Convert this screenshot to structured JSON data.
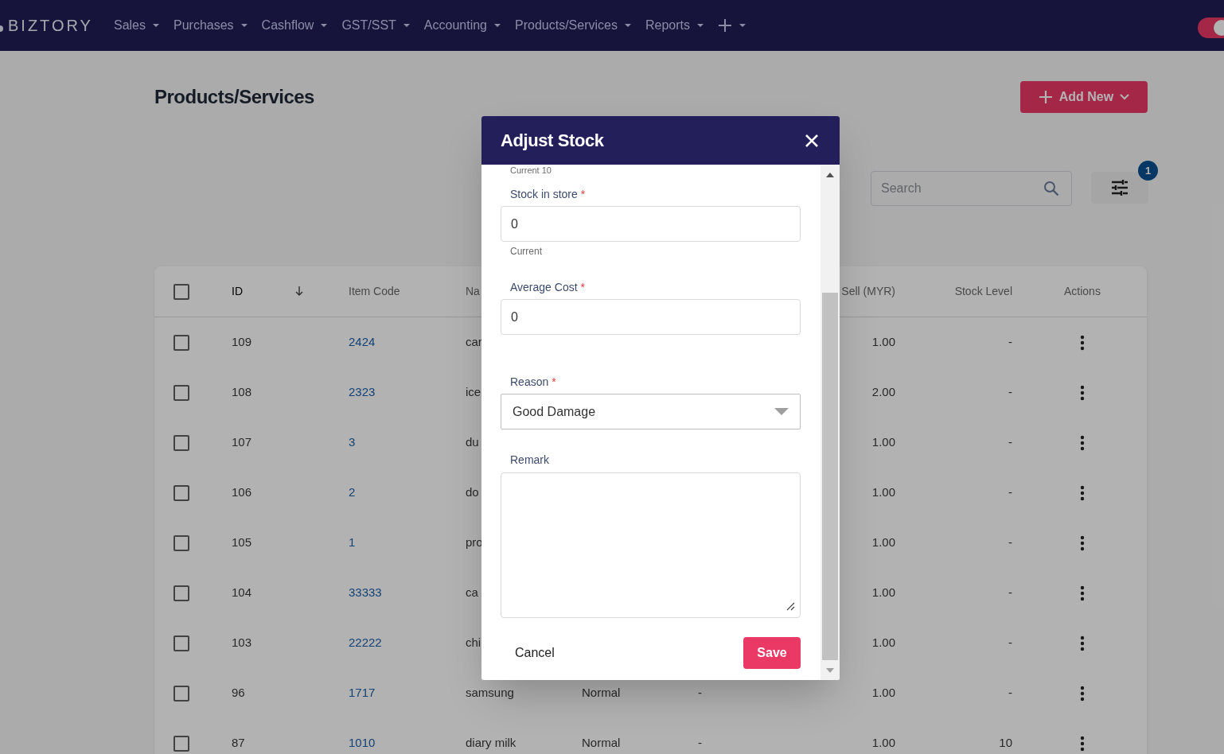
{
  "nav": {
    "logo": "BIZTORY",
    "items": [
      {
        "kind": "menu",
        "label": "Sales"
      },
      {
        "kind": "menu",
        "label": "Purchases"
      },
      {
        "kind": "menu",
        "label": "Cashflow"
      },
      {
        "kind": "menu",
        "label": "GST/SST"
      },
      {
        "kind": "menu",
        "label": "Accounting"
      },
      {
        "kind": "menu",
        "label": "Products/Services"
      },
      {
        "kind": "menu",
        "label": "Reports"
      },
      {
        "kind": "add"
      }
    ],
    "toggle": {
      "on": true
    }
  },
  "page": {
    "title": "Products/Services",
    "add_button": "Add New",
    "search": {
      "placeholder": "Search"
    },
    "filter_badge": "1"
  },
  "table": {
    "select_all": {
      "checked": false
    },
    "columns": [
      {
        "kind": "text",
        "label": "ID",
        "sorted": true
      },
      {
        "kind": "text",
        "label": "Item Code"
      },
      {
        "kind": "text",
        "label": "Na"
      },
      {
        "kind": "covered"
      },
      {
        "kind": "covered"
      },
      {
        "kind": "text",
        "label": "Sell (MYR)"
      },
      {
        "kind": "text",
        "label": "Stock Level"
      },
      {
        "kind": "text",
        "label": "Actions"
      }
    ],
    "rows": [
      {
        "checked": false,
        "id": "109",
        "item_code": "2424",
        "name": "car",
        "sell": "1.00",
        "stock_level": "-"
      },
      {
        "checked": false,
        "id": "108",
        "item_code": "2323",
        "name": "ice",
        "sell": "2.00",
        "stock_level": "-"
      },
      {
        "checked": false,
        "id": "107",
        "item_code": "3",
        "name": "du",
        "sell": "1.00",
        "stock_level": "-"
      },
      {
        "checked": false,
        "id": "106",
        "item_code": "2",
        "name": "do",
        "sell": "1.00",
        "stock_level": "-"
      },
      {
        "checked": false,
        "id": "105",
        "item_code": "1",
        "name": "pro",
        "sell": "1.00",
        "stock_level": "-"
      },
      {
        "checked": false,
        "id": "104",
        "item_code": "33333",
        "name": "ca",
        "sell": "1.00",
        "stock_level": "-"
      },
      {
        "checked": false,
        "id": "103",
        "item_code": "22222",
        "name": "chi",
        "sell": "1.00",
        "stock_level": "-"
      },
      {
        "checked": false,
        "id": "96",
        "item_code": "1717",
        "name": "samsung",
        "column_5": "Normal",
        "column_6": "-",
        "sell": "1.00",
        "stock_level": "-"
      },
      {
        "checked": false,
        "id": "87",
        "item_code": "1010",
        "name": "diary milk",
        "column_5": "Normal",
        "column_6": "-",
        "sell": "1.00",
        "stock_level": "10"
      }
    ]
  },
  "modal": {
    "title": "Adjust Stock",
    "scrolled_helper": "Current 10",
    "fields": [
      {
        "kind": "number",
        "label": "Stock in store",
        "required_mark": "*",
        "value": "0",
        "helper": "Current"
      },
      {
        "kind": "number",
        "label": "Average Cost",
        "required_mark": "*",
        "value": "0"
      },
      {
        "kind": "select",
        "label": "Reason",
        "required_mark": "*",
        "value": "Good Damage"
      },
      {
        "kind": "textarea",
        "label": "Remark"
      }
    ],
    "cancel": "Cancel",
    "save": "Save"
  }
}
